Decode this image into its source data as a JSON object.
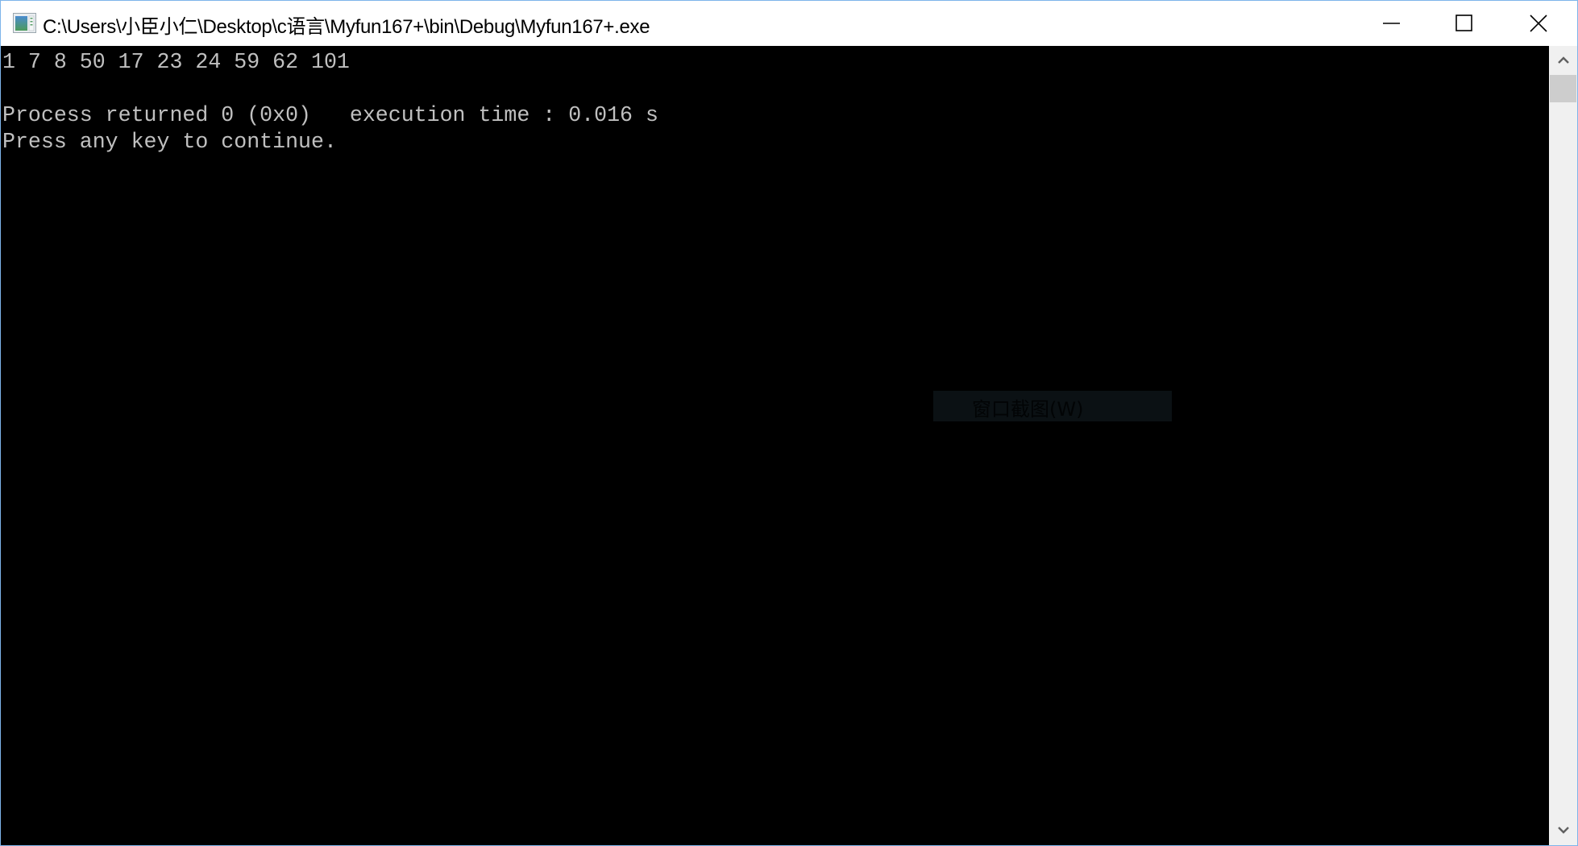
{
  "window": {
    "title": "C:\\Users\\小臣小仁\\Desktop\\c语言\\Myfun167+\\bin\\Debug\\Myfun167+.exe",
    "icon": "console-app-icon",
    "controls": {
      "minimize": "minimize-icon",
      "maximize": "maximize-icon",
      "close": "close-icon"
    }
  },
  "console": {
    "lines": [
      "1 7 8 50 17 23 24 59 62 101",
      "",
      "Process returned 0 (0x0)   execution time : 0.016 s",
      "Press any key to continue."
    ],
    "output_values": [
      1,
      7,
      8,
      50,
      17,
      23,
      24,
      59,
      62,
      101
    ],
    "return_code": "0 (0x0)",
    "execution_time": "0.016 s"
  },
  "overlay": {
    "label": "窗口截图(W)"
  },
  "scrollbar": {
    "up": "chevron-up-icon",
    "down": "chevron-down-icon"
  },
  "colors": {
    "console_bg": "#000000",
    "console_fg": "#c0c0c0",
    "window_border": "#7eb4ea",
    "scrollbar_bg": "#f0f0f0",
    "scroll_thumb": "#cdcdcd"
  }
}
